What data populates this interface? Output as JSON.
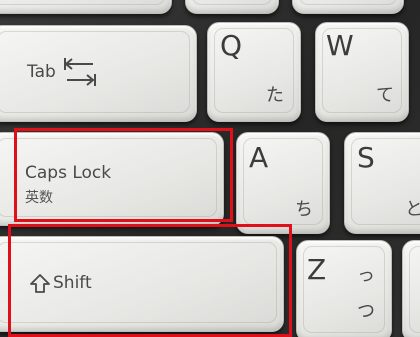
{
  "keys": {
    "tab": {
      "label": "Tab"
    },
    "q": {
      "letter": "Q",
      "kana": "た"
    },
    "w": {
      "letter": "W",
      "kana": "て"
    },
    "caps": {
      "label": "Caps Lock",
      "sub": "英数"
    },
    "a": {
      "letter": "A",
      "kana": "ち"
    },
    "s": {
      "letter": "S",
      "kana": "と"
    },
    "shift": {
      "label": "Shift"
    },
    "z": {
      "letter": "Z",
      "kana_top": "っ",
      "kana": "つ"
    }
  },
  "highlight_color": "#e0101a"
}
